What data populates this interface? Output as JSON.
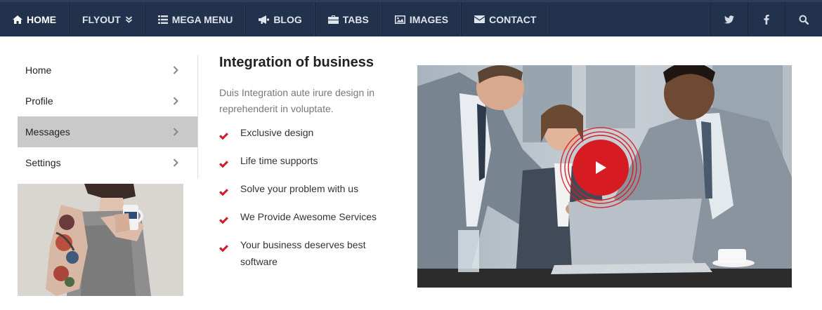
{
  "nav": {
    "items": [
      {
        "label": "HOME",
        "icon": "home-icon",
        "active": true
      },
      {
        "label": "FLYOUT",
        "icon": "",
        "dropdown": true
      },
      {
        "label": "MEGA MENU",
        "icon": "list-icon"
      },
      {
        "label": "BLOG",
        "icon": "megaphone-icon"
      },
      {
        "label": "TABS",
        "icon": "briefcase-icon"
      },
      {
        "label": "IMAGES",
        "icon": "image-icon"
      },
      {
        "label": "CONTACT",
        "icon": "envelope-icon"
      }
    ],
    "right_icons": [
      "twitter-icon",
      "facebook-icon",
      "search-icon"
    ],
    "background": "#22324d"
  },
  "sidebar": {
    "items": [
      {
        "label": "Home"
      },
      {
        "label": "Profile"
      },
      {
        "label": "Messages",
        "active": true
      },
      {
        "label": "Settings"
      }
    ]
  },
  "content": {
    "title": "Integration of business",
    "description": "Duis Integration aute irure design in reprehenderit in voluptate.",
    "features": [
      "Exclusive design",
      "Life time supports",
      "Solve your problem with us",
      "We Provide Awesome Services",
      "Your business deserves best software"
    ],
    "check_color": "#cc1f2a"
  },
  "video": {
    "play_color": "#d61c22"
  }
}
